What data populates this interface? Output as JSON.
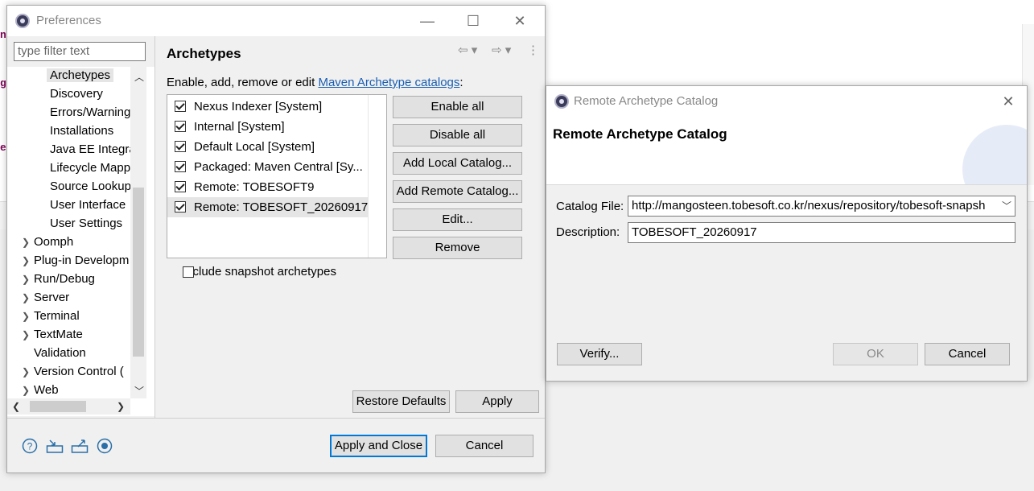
{
  "preferences": {
    "title": "Preferences",
    "filter_placeholder": "type filter text",
    "tree_items": [
      {
        "label": "Archetypes",
        "selected": true
      },
      {
        "label": "Discovery"
      },
      {
        "label": "Errors/Warning"
      },
      {
        "label": "Installations"
      },
      {
        "label": "Java EE Integra"
      },
      {
        "label": "Lifecycle Mapp"
      },
      {
        "label": "Source Lookup"
      },
      {
        "label": "User Interface"
      },
      {
        "label": "User Settings"
      },
      {
        "label": "Oomph"
      },
      {
        "label": "Plug-in Developm"
      },
      {
        "label": "Run/Debug"
      },
      {
        "label": "Server"
      },
      {
        "label": "Terminal"
      },
      {
        "label": "TextMate"
      },
      {
        "label": "Validation"
      },
      {
        "label": "Version Control ("
      },
      {
        "label": "Web"
      }
    ],
    "page": {
      "title": "Archetypes",
      "description_prefix": "Enable, add, remove or edit ",
      "description_link": "Maven Archetype catalogs",
      "description_suffix": ":",
      "catalogs": [
        {
          "label": "Nexus Indexer [System]",
          "checked": true
        },
        {
          "label": "Internal [System]",
          "checked": true
        },
        {
          "label": "Default Local [System]",
          "checked": true
        },
        {
          "label": "Packaged: Maven Central [Sy...",
          "checked": true
        },
        {
          "label": "Remote: TOBESOFT9",
          "checked": true
        },
        {
          "label": "Remote: TOBESOFT_20260917",
          "checked": true,
          "selected": true
        }
      ],
      "buttons": {
        "enable_all": "Enable all",
        "disable_all": "Disable all",
        "add_local": "Add Local Catalog...",
        "add_remote": "Add Remote Catalog...",
        "edit": "Edit...",
        "remove": "Remove"
      },
      "include_snapshot": "Include snapshot archetypes",
      "restore_defaults": "Restore Defaults",
      "apply": "Apply"
    },
    "apply_and_close": "Apply and Close",
    "cancel": "Cancel"
  },
  "remote_dialog": {
    "title": "Remote Archetype Catalog",
    "heading": "Remote Archetype Catalog",
    "catalog_file_label": "Catalog File:",
    "catalog_file_value": "http://mangosteen.tobesoft.co.kr/nexus/repository/tobesoft-snapsh",
    "description_label": "Description:",
    "description_value": "TOBESOFT_20260917",
    "verify": "Verify...",
    "ok": "OK",
    "cancel": "Cancel"
  }
}
